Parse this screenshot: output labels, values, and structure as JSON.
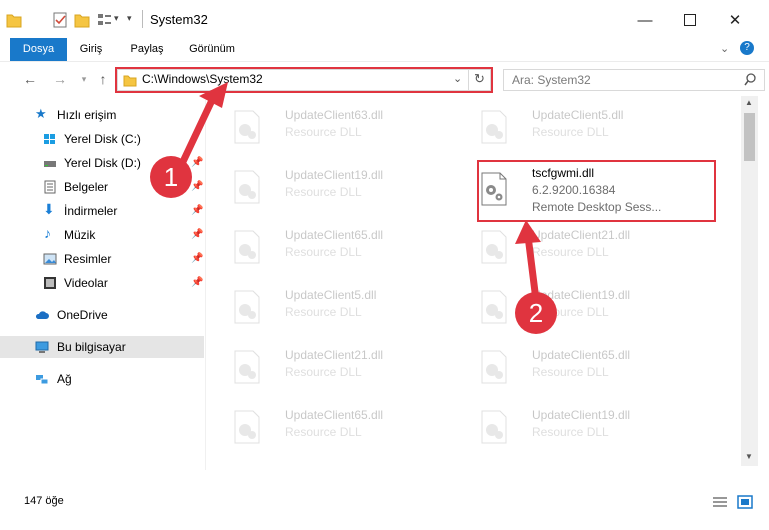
{
  "window": {
    "title": "System32"
  },
  "ribbon": {
    "tabs": [
      "Dosya",
      "Giriş",
      "Paylaş",
      "Görünüm"
    ]
  },
  "nav": {
    "address": "C:\\Windows\\System32",
    "search_placeholder": "Ara: System32"
  },
  "sidebar": {
    "items": [
      {
        "label": "Hızlı erişim"
      },
      {
        "label": "Yerel Disk (C:)"
      },
      {
        "label": "Yerel Disk (D:)"
      },
      {
        "label": "Belgeler"
      },
      {
        "label": "İndirmeler"
      },
      {
        "label": "Müzik"
      },
      {
        "label": "Resimler"
      },
      {
        "label": "Videolar"
      },
      {
        "label": "OneDrive"
      },
      {
        "label": "Bu bilgisayar"
      },
      {
        "label": "Ağ"
      }
    ]
  },
  "files": {
    "left": [
      {
        "name": "UpdateClient63.dll",
        "desc": "Resource DLL"
      },
      {
        "name": "UpdateClient19.dll",
        "desc": "Resource DLL"
      },
      {
        "name": "UpdateClient65.dll",
        "desc": "Resource DLL"
      },
      {
        "name": "UpdateClient5.dll",
        "desc": "Resource DLL"
      },
      {
        "name": "UpdateClient21.dll",
        "desc": "Resource DLL"
      },
      {
        "name": "UpdateClient65.dll",
        "desc": "Resource DLL"
      }
    ],
    "right": [
      {
        "name": "UpdateClient5.dll",
        "desc": "Resource DLL"
      },
      {
        "name": "UpdateClient21.dll",
        "desc": "Resource DLL"
      },
      {
        "name": "UpdateClient19.dll",
        "desc": "Resource DLL"
      },
      {
        "name": "UpdateClient65.dll",
        "desc": "Resource DLL"
      },
      {
        "name": "UpdateClient19.dll",
        "desc": "Resource DLL"
      }
    ],
    "highlighted": {
      "name": "tscfgwmi.dll",
      "version": "6.2.9200.16384",
      "desc": "Remote Desktop Sess..."
    }
  },
  "status": {
    "count": "147 öğe"
  },
  "annotations": {
    "step1": "1",
    "step2": "2"
  },
  "colors": {
    "accent": "#1979ca",
    "highlight": "#e0343f"
  }
}
